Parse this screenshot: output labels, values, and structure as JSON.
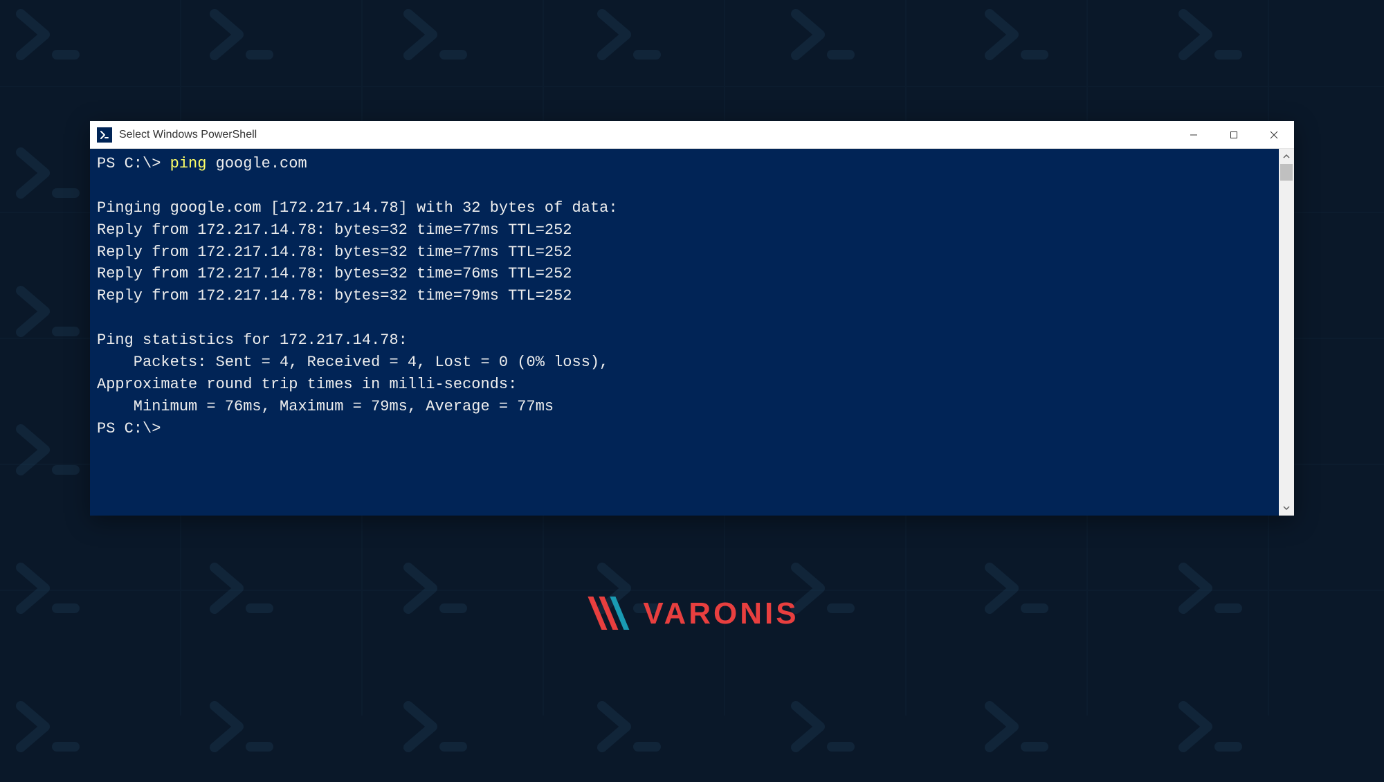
{
  "window": {
    "title": "Select Windows PowerShell",
    "icon_glyph": ">_"
  },
  "terminal": {
    "prompt1_prefix": "PS C:\\> ",
    "command": "ping",
    "command_args": " google.com",
    "blank1": "",
    "line_pinging": "Pinging google.com [172.217.14.78] with 32 bytes of data:",
    "reply1": "Reply from 172.217.14.78: bytes=32 time=77ms TTL=252",
    "reply2": "Reply from 172.217.14.78: bytes=32 time=77ms TTL=252",
    "reply3": "Reply from 172.217.14.78: bytes=32 time=76ms TTL=252",
    "reply4": "Reply from 172.217.14.78: bytes=32 time=79ms TTL=252",
    "blank2": "",
    "stats_header": "Ping statistics for 172.217.14.78:",
    "packets": "    Packets: Sent = 4, Received = 4, Lost = 0 (0% loss),",
    "approx": "Approximate round trip times in milli-seconds:",
    "rtt": "    Minimum = 76ms, Maximum = 79ms, Average = 77ms",
    "prompt2": "PS C:\\>"
  },
  "logo": {
    "text": "VARONIS"
  }
}
